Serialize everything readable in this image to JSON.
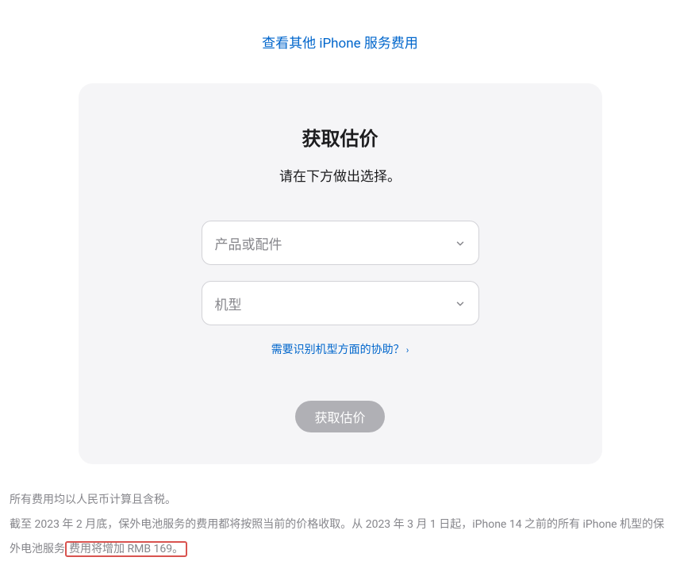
{
  "topLink": {
    "label": "查看其他 iPhone 服务费用"
  },
  "card": {
    "title": "获取估价",
    "subtitle": "请在下方做出选择。",
    "select1": {
      "placeholder": "产品或配件"
    },
    "select2": {
      "placeholder": "机型"
    },
    "helpLink": {
      "label": "需要识别机型方面的协助？"
    },
    "button": {
      "label": "获取估价"
    }
  },
  "footer": {
    "line1": "所有费用均以人民币计算且含税。",
    "line2_part1": "截至 2023 年 2 月底，保外电池服务的费用都将按照当前的价格收取。从 2023 年 3 月 1 日起，iPhone 14 之前的所有 iPhone 机型的保外电池服务",
    "line2_highlight": "费用将增加 RMB 169。"
  }
}
